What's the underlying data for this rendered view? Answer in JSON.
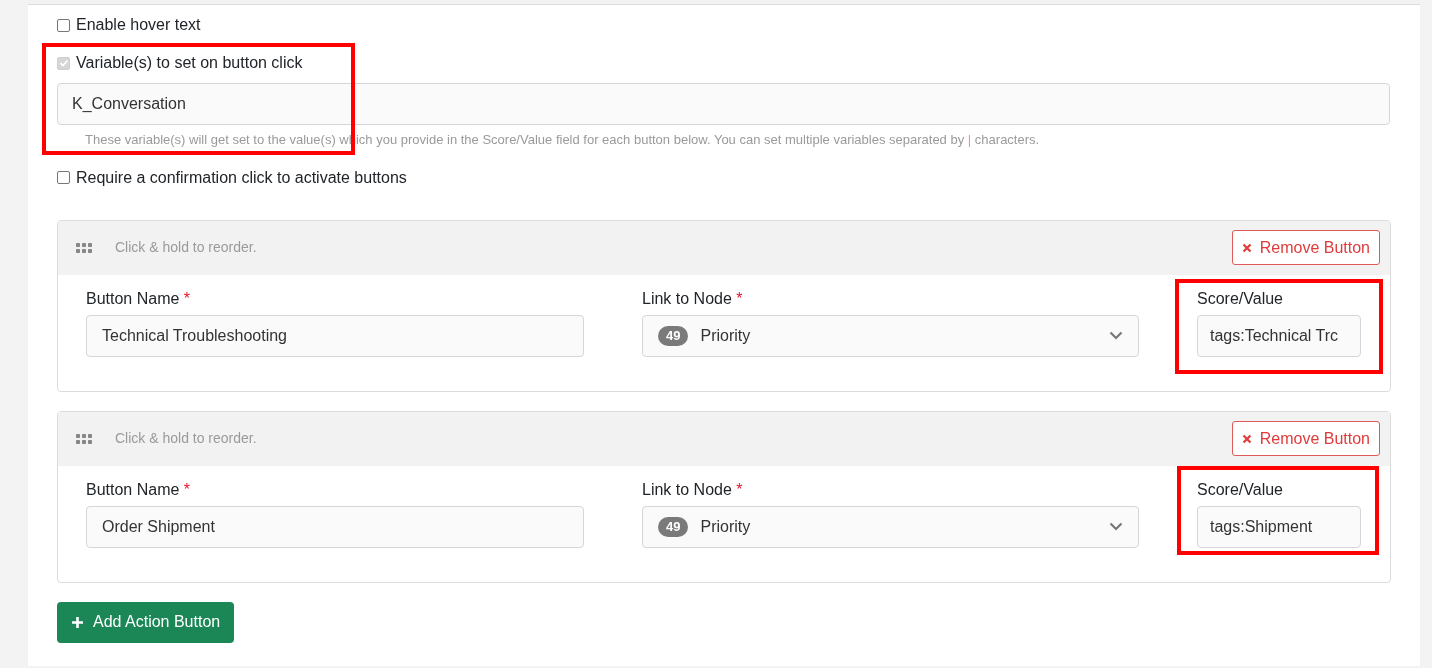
{
  "options": [
    {
      "label": "Enable hover text",
      "checked": false,
      "disabled": false
    },
    {
      "label": "Variable(s) to set on button click",
      "checked": true,
      "disabled": true,
      "highlighted": true,
      "value": "K_Conversation",
      "help": {
        "before": "These variable(s) will get set to the value(s) which you provide in the Score/Value field for each button below. You can set multiple variables separated by",
        "separator": "|",
        "after": "characters."
      }
    },
    {
      "label": "Require a confirmation click to activate buttons",
      "checked": false,
      "disabled": false
    }
  ],
  "buttons": [
    {
      "drag_hint": "Click & hold to reorder.",
      "remove": "Remove Button",
      "name_label": "Button Name",
      "name_required": "*",
      "name": "Technical Troubleshooting",
      "node_label": "Link to Node",
      "node_required": "*",
      "node_number": "49",
      "node": "Priority",
      "score_label": "Score/Value",
      "score": "tags:Technical Trc",
      "score_highlighted": true
    },
    {
      "drag_hint": "Click & hold to reorder.",
      "remove": "Remove Button",
      "name_label": "Button Name",
      "name_required": "*",
      "name": "Order Shipment",
      "node_label": "Link to Node",
      "node_required": "*",
      "node_number": "49",
      "node": "Priority",
      "score_label": "Score/Value",
      "score": "tags:Shipment",
      "score_highlighted": true
    }
  ],
  "add_button": "Add Action Button"
}
